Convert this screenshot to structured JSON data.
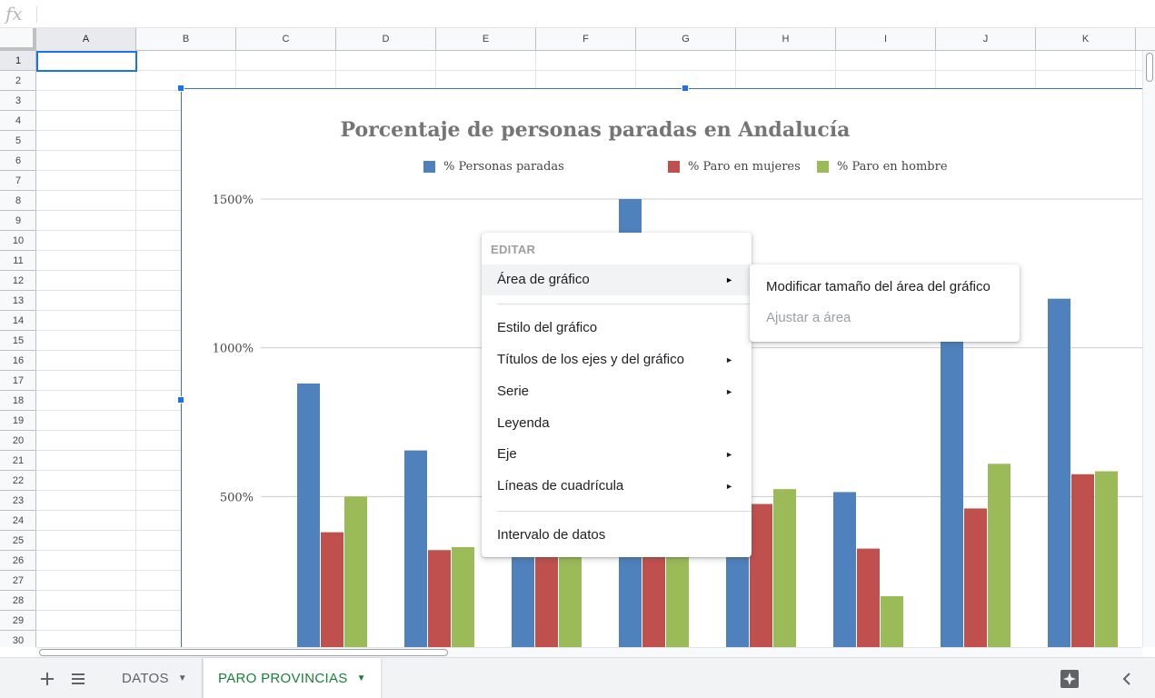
{
  "formula_bar": {
    "fx_label": "fx",
    "value": ""
  },
  "columns": [
    "A",
    "B",
    "C",
    "D",
    "E",
    "F",
    "G",
    "H",
    "I",
    "J",
    "K"
  ],
  "rows": [
    "1",
    "2",
    "3",
    "4",
    "5",
    "6",
    "7",
    "8",
    "9",
    "10",
    "11",
    "12",
    "13",
    "14",
    "15",
    "16",
    "17",
    "18",
    "19",
    "20",
    "21",
    "22",
    "23",
    "24",
    "25",
    "26",
    "27",
    "28",
    "29",
    "30"
  ],
  "selected_cell": {
    "column": "A",
    "row": "1"
  },
  "chart_data": {
    "type": "bar",
    "title": "Porcentaje de personas paradas en Andalucía",
    "legend_position": "top",
    "ylim": [
      0,
      1500
    ],
    "y_ticks": [
      "500%",
      "1000%",
      "1500%"
    ],
    "y_tick_values": [
      500,
      1000,
      1500
    ],
    "gridlines": true,
    "series": [
      {
        "name": "% Personas paradas",
        "color": "#4f81bd",
        "values": [
          880,
          655,
          330,
          1500,
          350,
          515,
          1050,
          1165
        ]
      },
      {
        "name": "% Paro en mujeres",
        "color": "#c0504d",
        "values": [
          380,
          320,
          335,
          350,
          475,
          325,
          460,
          575
        ]
      },
      {
        "name": "% Paro en hombre",
        "color": "#9bbb59",
        "values": [
          500,
          330,
          320,
          320,
          525,
          165,
          610,
          585
        ]
      }
    ]
  },
  "context_menu": {
    "header": "EDITAR",
    "items": [
      {
        "label": "Área de gráfico",
        "has_submenu": true,
        "highlighted": true
      },
      {
        "label": "Estilo del gráfico",
        "has_submenu": false
      },
      {
        "label": "Títulos de los ejes y del gráfico",
        "has_submenu": true
      },
      {
        "label": "Serie",
        "has_submenu": true
      },
      {
        "label": "Leyenda",
        "has_submenu": false
      },
      {
        "label": "Eje",
        "has_submenu": true
      },
      {
        "label": "Líneas de cuadrícula",
        "has_submenu": true
      },
      {
        "label": "Intervalo de datos",
        "has_submenu": false
      }
    ],
    "arrow_glyph": "►"
  },
  "submenu": {
    "items": [
      {
        "label": "Modificar tamaño del área del gráfico",
        "disabled": false
      },
      {
        "label": "Ajustar a área",
        "disabled": true
      }
    ]
  },
  "bottom_bar": {
    "add_sheet_icon": "plus-icon",
    "all_sheets_icon": "list-icon",
    "tabs": [
      {
        "label": "DATOS",
        "active": false
      },
      {
        "label": "PARO PROVINCIAS",
        "active": true
      }
    ],
    "explore_icon": "explore-icon",
    "collapse_icon": "chevron-left-icon",
    "active_tab_color": "#188038"
  }
}
